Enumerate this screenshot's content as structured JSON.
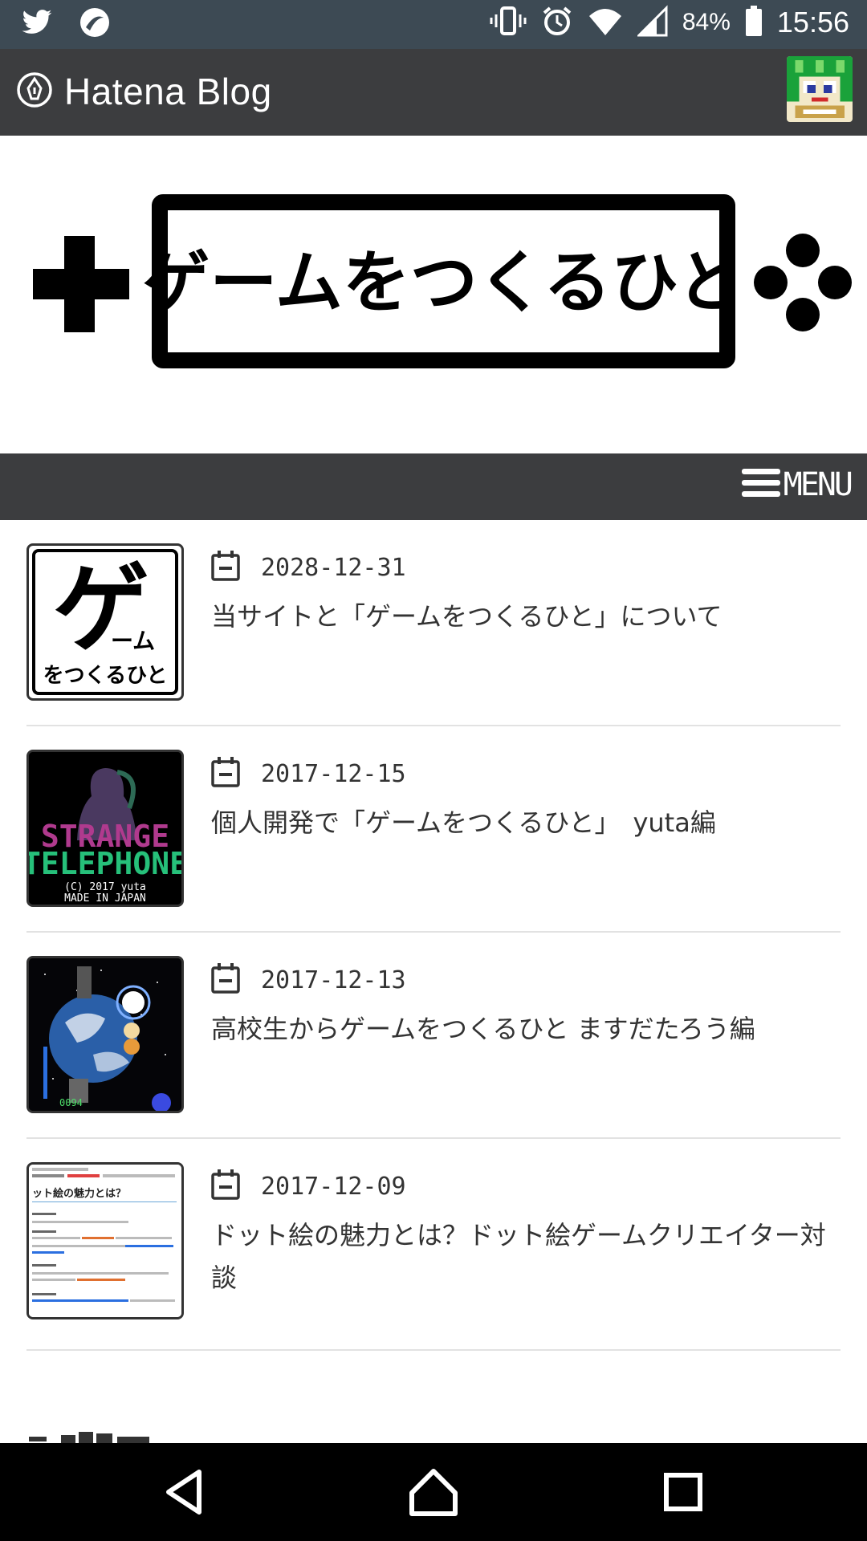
{
  "status_bar": {
    "battery": "84%",
    "time": "15:56",
    "icons": [
      "twitter-icon",
      "app-icon",
      "vibrate-icon",
      "alarm-icon",
      "wifi-icon",
      "signal-icon",
      "battery-icon"
    ]
  },
  "header": {
    "brand": "Hatena Blog",
    "brand_icon": "pen-icon",
    "avatar": "pixel-avatar"
  },
  "banner": {
    "title": "ゲームをつくるひと",
    "left_icon": "dpad-icon",
    "right_icon": "buttons-icon"
  },
  "menu": {
    "label": "MENU",
    "icon": "hamburger-icon"
  },
  "articles": [
    {
      "date": "2028-12-31",
      "title": "当サイトと「ゲームをつくるひと」について",
      "thumb": "site-logo"
    },
    {
      "date": "2017-12-15",
      "title": "個人開発で「ゲームをつくるひと」　yuta編",
      "thumb": "strange-telephone",
      "thumb_text": [
        "STRANGE",
        "TELEPHONE",
        "(C) 2017 yuta",
        "MADE IN JAPAN"
      ]
    },
    {
      "date": "2017-12-13",
      "title": "高校生からゲームをつくるひと ますだたろう編",
      "thumb": "shooter-game"
    },
    {
      "date": "2017-12-09",
      "title": "ドット絵の魅力とは？ドット絵ゲームクリエイター対談",
      "thumb": "interview-doc",
      "thumb_text": [
        "ット絵の魅力とは？"
      ]
    }
  ],
  "logo_thumb": {
    "line1": "ゲ",
    "line2": "ーム",
    "line3": "をつくるひと"
  },
  "colors": {
    "header_bg": "#3c3d3f",
    "status_bg": "#3d4a54",
    "text": "#333333",
    "divider": "#e2e2e2"
  }
}
